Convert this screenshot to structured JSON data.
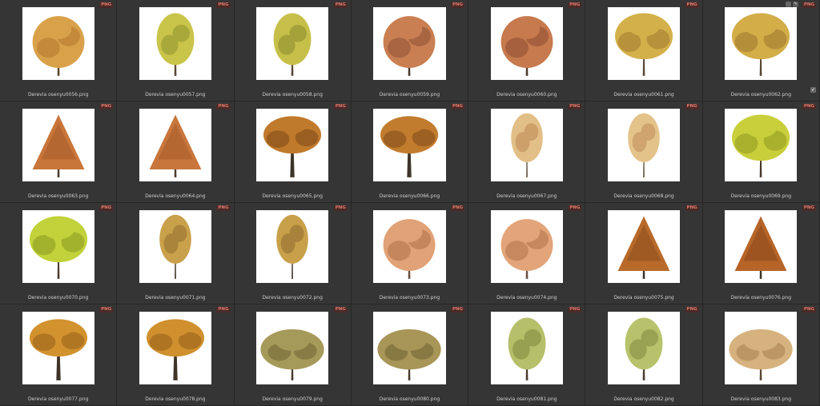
{
  "badge_label": "PNG",
  "colors": {
    "background": "#2b2b2b",
    "cell": "#353535",
    "badge_bg": "#4a2a28",
    "badge_text": "#e07a6a"
  },
  "items": [
    {
      "name": "Derevia osenyu0056.png",
      "shape": "round",
      "crown": "#d9a24a",
      "accent": "#c48a3a",
      "trunk": "#5a4632"
    },
    {
      "name": "Derevia osenyu0057.png",
      "shape": "oval",
      "crown": "#c9c44a",
      "accent": "#a9a83a",
      "trunk": "#5a4632"
    },
    {
      "name": "Derevia osenyu0058.png",
      "shape": "oval",
      "crown": "#c6c04a",
      "accent": "#a6a23a",
      "trunk": "#5a4632"
    },
    {
      "name": "Derevia osenyu0059.png",
      "shape": "round",
      "crown": "#c97f52",
      "accent": "#a96542",
      "trunk": "#4a3a2c"
    },
    {
      "name": "Derevia osenyu0060.png",
      "shape": "round",
      "crown": "#c67a4e",
      "accent": "#a6603e",
      "trunk": "#4a3a2c"
    },
    {
      "name": "Derevia osenyu0061.png",
      "shape": "wide",
      "crown": "#d4b04a",
      "accent": "#b8923a",
      "trunk": "#5a4632"
    },
    {
      "name": "Derevia osenyu0062.png",
      "shape": "wide",
      "crown": "#d2ad48",
      "accent": "#b48e38",
      "trunk": "#5a4632",
      "overlay": true
    },
    {
      "name": "Derevia osenyu0063.png",
      "shape": "cone",
      "crown": "#c9763a",
      "accent": "#a85e2c",
      "trunk": "#4a3a2c"
    },
    {
      "name": "Derevia osenyu0064.png",
      "shape": "cone",
      "crown": "#c8763c",
      "accent": "#a85e2c",
      "trunk": "#4a3a2c"
    },
    {
      "name": "Derevia osenyu0065.png",
      "shape": "umbrella",
      "crown": "#c07a2c",
      "accent": "#9a5e20",
      "trunk": "#3e3428"
    },
    {
      "name": "Derevia osenyu0066.png",
      "shape": "umbrella",
      "crown": "#c27c2e",
      "accent": "#9c6022",
      "trunk": "#3e3428"
    },
    {
      "name": "Derevia osenyu0067.png",
      "shape": "slim",
      "crown": "#e2bf86",
      "accent": "#cda06a",
      "trunk": "#6a5a48"
    },
    {
      "name": "Derevia osenyu0068.png",
      "shape": "slim",
      "crown": "#e4c38a",
      "accent": "#cfa46e",
      "trunk": "#6a5a48"
    },
    {
      "name": "Derevia osenyu0069.png",
      "shape": "wide",
      "crown": "#c8cf3a",
      "accent": "#a8b02c",
      "trunk": "#4a3a2c"
    },
    {
      "name": "Derevia osenyu0070.png",
      "shape": "wide",
      "crown": "#c2d23a",
      "accent": "#a2b22c",
      "trunk": "#4a3a2c"
    },
    {
      "name": "Derevia osenyu0071.png",
      "shape": "slim",
      "crown": "#c9a14a",
      "accent": "#a9843a",
      "trunk": "#4a3a2c"
    },
    {
      "name": "Derevia osenyu0072.png",
      "shape": "slim",
      "crown": "#c8a04a",
      "accent": "#a8823a",
      "trunk": "#4a3a2c"
    },
    {
      "name": "Derevia osenyu0073.png",
      "shape": "round",
      "crown": "#e0a276",
      "accent": "#c6865c",
      "trunk": "#6a5040"
    },
    {
      "name": "Derevia osenyu0074.png",
      "shape": "round",
      "crown": "#e2a478",
      "accent": "#c8885e",
      "trunk": "#6a5040"
    },
    {
      "name": "Derevia osenyu0075.png",
      "shape": "cone",
      "crown": "#b86a2a",
      "accent": "#8e4e1e",
      "trunk": "#3e3428"
    },
    {
      "name": "Derevia osenyu0076.png",
      "shape": "cone",
      "crown": "#b66428",
      "accent": "#8c4a1c",
      "trunk": "#3e3428"
    },
    {
      "name": "Derevia osenyu0077.png",
      "shape": "umbrella",
      "crown": "#d2922e",
      "accent": "#b07622",
      "trunk": "#3e3428"
    },
    {
      "name": "Derevia osenyu0078.png",
      "shape": "umbrella",
      "crown": "#d0902e",
      "accent": "#ae7422",
      "trunk": "#3e3428"
    },
    {
      "name": "Derevia osenyu0079.png",
      "shape": "dome",
      "crown": "#a69a5a",
      "accent": "#877c44",
      "trunk": "#4a3a2c"
    },
    {
      "name": "Derevia osenyu0080.png",
      "shape": "dome",
      "crown": "#a89658",
      "accent": "#887842",
      "trunk": "#4a3a2c"
    },
    {
      "name": "Derevia osenyu0081.png",
      "shape": "oval",
      "crown": "#b6bf6a",
      "accent": "#96a050",
      "trunk": "#4a3a2c"
    },
    {
      "name": "Derevia osenyu0082.png",
      "shape": "oval",
      "crown": "#b8c26c",
      "accent": "#98a252",
      "trunk": "#4a3a2c"
    },
    {
      "name": "Derevia osenyu0083.png",
      "shape": "dome",
      "crown": "#d6b27e",
      "accent": "#bc9664",
      "trunk": "#5a4632",
      "check": true
    }
  ]
}
